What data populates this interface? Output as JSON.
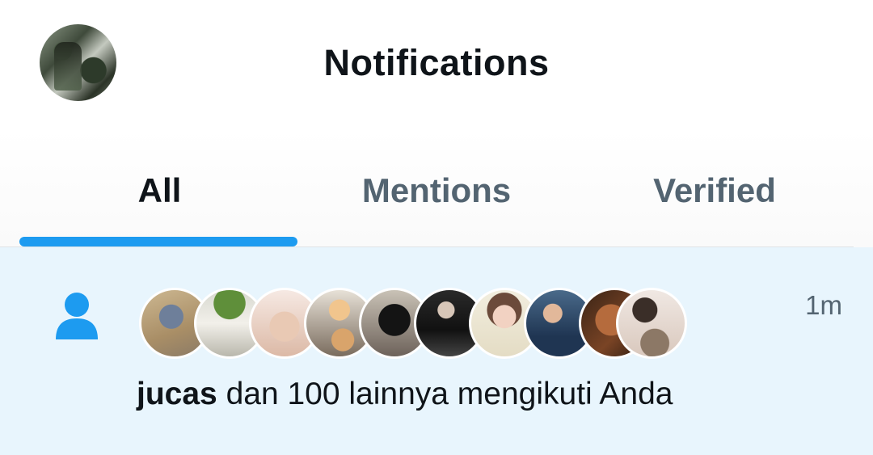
{
  "header": {
    "title": "Notifications",
    "profile_avatar": "profile-photo"
  },
  "tabs": [
    {
      "label": "All",
      "active": true
    },
    {
      "label": "Mentions",
      "active": false
    },
    {
      "label": "Verified",
      "active": false
    }
  ],
  "colors": {
    "accent": "#1d9bf0",
    "highlight_bg": "#e8f5fd",
    "text_primary": "#0f1419",
    "text_secondary": "#536471"
  },
  "notification": {
    "icon": "person-icon",
    "time": "1m",
    "name": "jucas",
    "message": " dan 100 lainnya mengikuti Anda",
    "follower_avatars": [
      "cartoon-cat-avatar",
      "garden-photo-avatar",
      "bunny-plush-avatar",
      "cat-photo-avatar",
      "black-cat-hood-avatar",
      "dark-portrait-avatar",
      "anime-girl-flowers-avatar",
      "hijab-portrait-avatar",
      "face-closeup-avatar",
      "person-with-cat-avatar"
    ]
  }
}
